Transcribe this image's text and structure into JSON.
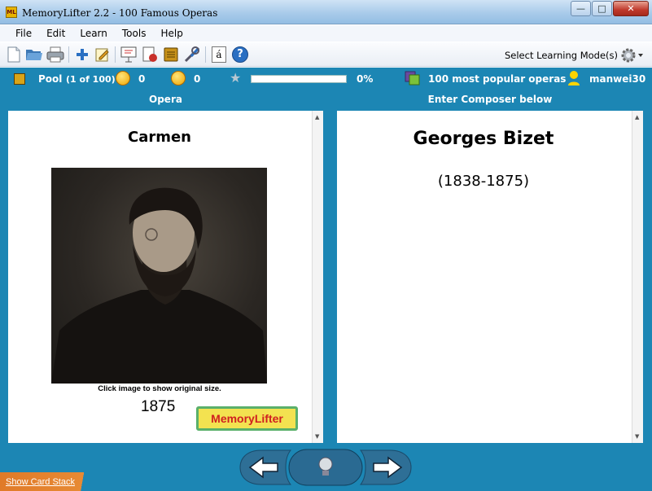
{
  "window": {
    "title": "MemoryLifter 2.2 - 100 Famous Operas",
    "app_icon_text": "ML",
    "minimize": "—",
    "maximize": "□",
    "close": "✕"
  },
  "menu": [
    "File",
    "Edit",
    "Learn",
    "Tools",
    "Help"
  ],
  "toolbar": {
    "icons": [
      "new-icon",
      "open-icon",
      "print-icon",
      "add-card-icon",
      "edit-icon",
      "presentation-icon",
      "print-cards-icon",
      "dictionary-icon",
      "tools-icon",
      "special-char-icon",
      "help-icon"
    ],
    "special_char_label": "á",
    "help_label": "?",
    "select_mode_label": "Select Learning Mode(s)"
  },
  "status": {
    "pool_label": "Pool",
    "pool_count": "(1 of 100)",
    "correct_count": "0",
    "wrong_count": "0",
    "progress_percent": 0,
    "progress_label": "0%",
    "learning_set": "100 most popular operas",
    "user": "manwei30"
  },
  "question": {
    "header": "Opera",
    "title": "Carmen",
    "image_caption": "Click image to show original size.",
    "year": "1875",
    "logo_text": "MemoryLifter"
  },
  "answer": {
    "header": "Enter Composer below",
    "title": "Georges Bizet",
    "subtitle": "(1838-1875)"
  },
  "footer": {
    "show_card_stack": "Show Card Stack"
  },
  "colors": {
    "background_blue": "#1c86b4",
    "progress_green": "#7bbf3a",
    "card_stack_orange": "#e07a28"
  }
}
